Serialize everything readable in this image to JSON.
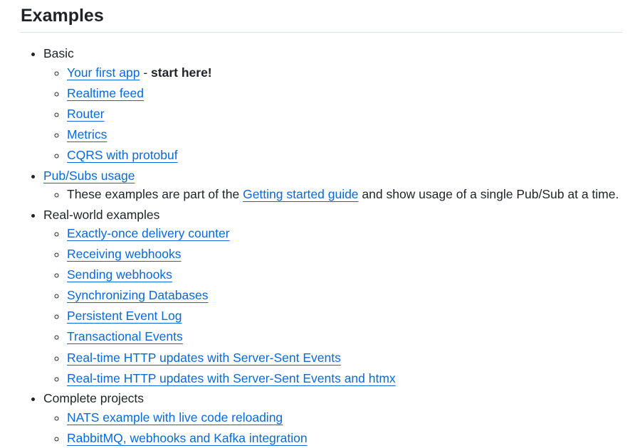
{
  "heading": "Examples",
  "sections": {
    "basic": {
      "label": "Basic",
      "first_app": {
        "link": "Your first app",
        "separator": " - ",
        "emphasis": "start here!"
      },
      "links": [
        "Realtime feed",
        "Router",
        "Metrics",
        "CQRS with protobuf"
      ]
    },
    "pubsub": {
      "link": "Pub/Subs usage",
      "note": {
        "before": "These examples are part of the ",
        "link": "Getting started guide",
        "after": " and show usage of a single Pub/Sub at a time."
      }
    },
    "real_world": {
      "label": "Real-world examples",
      "links": [
        "Exactly-once delivery counter",
        "Receiving webhooks",
        "Sending webhooks",
        "Synchronizing Databases",
        "Persistent Event Log",
        "Transactional Events",
        "Real-time HTTP updates with Server-Sent Events",
        "Real-time HTTP updates with Server-Sent Events and htmx"
      ]
    },
    "complete": {
      "label": "Complete projects",
      "links": [
        "NATS example with live code reloading",
        "RabbitMQ, webhooks and Kafka integration"
      ]
    }
  }
}
